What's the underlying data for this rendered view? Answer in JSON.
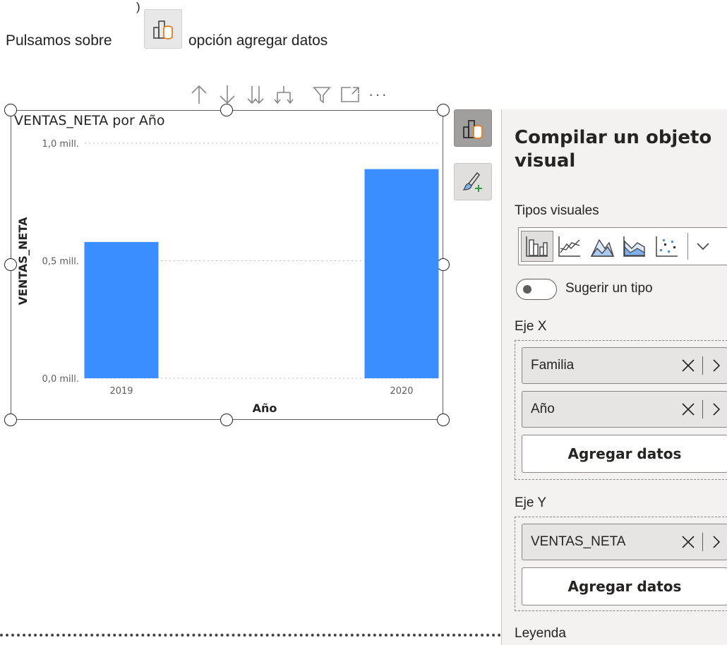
{
  "instruction": {
    "paren": ")",
    "before": "Pulsamos sobre",
    "after": "opción agregar datos",
    "button_icon": "build-visual-icon"
  },
  "toolbar": {
    "icons": [
      "drill-up-icon",
      "drill-down-icon",
      "expand-next-level-icon",
      "expand-hierarchy-icon",
      "filter-icon",
      "focus-mode-icon",
      "more-options-icon"
    ],
    "more_label": "···"
  },
  "chart_data": {
    "type": "bar",
    "title": "VENTAS_NETA por Año",
    "xlabel": "Año",
    "ylabel": "VENTAS_NETA",
    "categories": [
      "2019",
      "2020"
    ],
    "values": [
      0.58,
      0.89
    ],
    "yticks": [
      "0,0 mill.",
      "0,5 mill.",
      "1,0 mill."
    ],
    "ytick_values": [
      0,
      0.5,
      1.0
    ],
    "ylim": [
      0,
      1.0
    ],
    "grid": true,
    "bar_color": "#3a8eff"
  },
  "side_buttons": {
    "build": "build-visual-icon",
    "format": "format-visual-icon"
  },
  "pane": {
    "title": "Compilar un objeto visual",
    "visual_types_label": "Tipos visuales",
    "visual_types": [
      "clustered-column-icon",
      "line-chart-icon",
      "area-chart-icon",
      "stacked-area-icon",
      "scatter-chart-icon"
    ],
    "suggest_label": "Sugerir un tipo",
    "x_axis": {
      "label": "Eje X",
      "fields": [
        "Familia",
        "Año"
      ],
      "add_label": "Agregar datos"
    },
    "y_axis": {
      "label": "Eje Y",
      "fields": [
        "VENTAS_NETA"
      ],
      "add_label": "Agregar datos"
    },
    "legend_label": "Leyenda"
  }
}
